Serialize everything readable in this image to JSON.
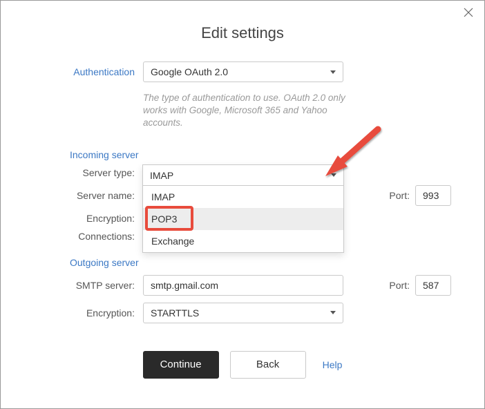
{
  "title": "Edit settings",
  "auth": {
    "label": "Authentication",
    "value": "Google OAuth 2.0",
    "helper": "The type of authentication to use. OAuth 2.0 only works with Google, Microsoft 365 and Yahoo accounts."
  },
  "incoming": {
    "section": "Incoming server",
    "server_type_label": "Server type:",
    "server_type_value": "IMAP",
    "server_name_label": "Server name:",
    "encryption_label": "Encryption:",
    "connections_label": "Connections:",
    "port_label": "Port:",
    "port_value": "993",
    "dropdown": {
      "options": [
        "IMAP",
        "POP3",
        "Exchange"
      ],
      "highlighted": "POP3"
    }
  },
  "outgoing": {
    "section": "Outgoing server",
    "smtp_label": "SMTP server:",
    "smtp_value": "smtp.gmail.com",
    "encryption_label": "Encryption:",
    "encryption_value": "STARTTLS",
    "port_label": "Port:",
    "port_value": "587"
  },
  "buttons": {
    "continue": "Continue",
    "back": "Back",
    "help": "Help"
  }
}
